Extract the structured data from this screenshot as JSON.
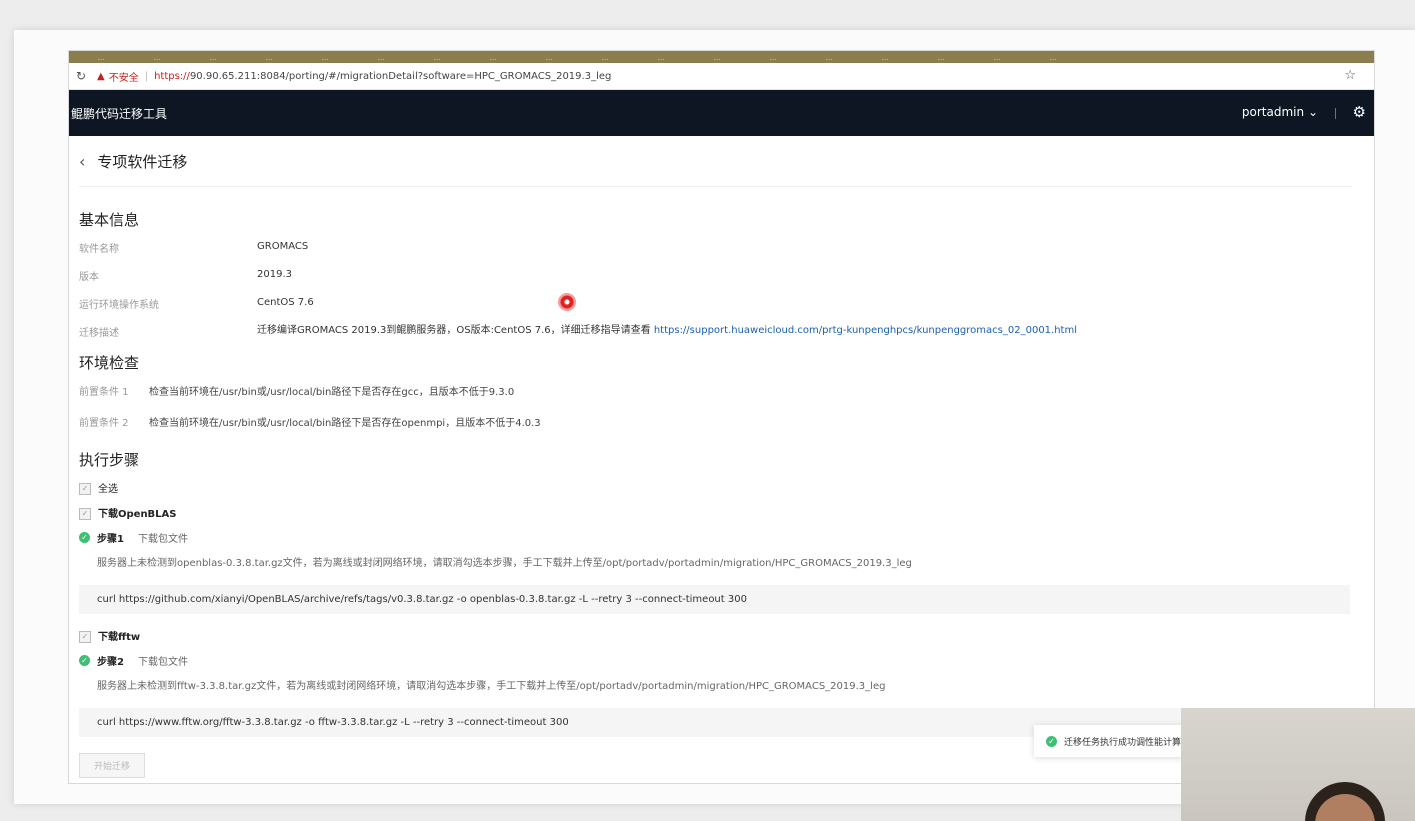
{
  "browser": {
    "tabs": [
      "...",
      "...",
      "...",
      "...",
      "...",
      "...",
      "...",
      "...",
      "...",
      "...",
      "...",
      "...",
      "...",
      "...",
      "...",
      "...",
      "...",
      "..."
    ],
    "address": {
      "insecure_label": "不安全",
      "url_https": "https://",
      "url_rest": "90.90.65.211:8084/porting/#/migrationDetail?software=HPC_GROMACS_2019.3_leg"
    }
  },
  "app": {
    "title": "鲲鹏代码迁移工具",
    "user": "portadmin"
  },
  "page": {
    "title": "专项软件迁移",
    "basic": {
      "heading": "基本信息",
      "rows": [
        {
          "label": "软件名称",
          "value": "GROMACS"
        },
        {
          "label": "版本",
          "value": "2019.3"
        },
        {
          "label": "运行环境操作系统",
          "value": "CentOS 7.6"
        }
      ],
      "desc_label": "迁移描述",
      "desc_text": "迁移编译GROMACS 2019.3到鲲鹏服务器，OS版本:CentOS 7.6，详细迁移指导请查看 ",
      "desc_link": "https://support.huaweicloud.com/prtg-kunpenghpcs/kunpenggromacs_02_0001.html"
    },
    "env": {
      "heading": "环境检查",
      "rows": [
        {
          "label": "前置条件 1",
          "value": "检查当前环境在/usr/bin或/usr/local/bin路径下是否存在gcc，且版本不低于9.3.0"
        },
        {
          "label": "前置条件 2",
          "value": "检查当前环境在/usr/bin或/usr/local/bin路径下是否存在openmpi，且版本不低于4.0.3"
        }
      ]
    },
    "steps": {
      "heading": "执行步骤",
      "select_all": "全选",
      "groups": [
        {
          "name": "下载OpenBLAS",
          "step": "步骤1",
          "step_desc": "下载包文件",
          "note": "服务器上未检测到openblas-0.3.8.tar.gz文件，若为离线或封闭网络环境，请取消勾选本步骤，手工下载并上传至/opt/portadv/portadmin/migration/HPC_GROMACS_2019.3_leg",
          "cmd": "curl https://github.com/xianyi/OpenBLAS/archive/refs/tags/v0.3.8.tar.gz -o openblas-0.3.8.tar.gz -L --retry 3 --connect-timeout 300"
        },
        {
          "name": "下载fftw",
          "step": "步骤2",
          "step_desc": "下载包文件",
          "note": "服务器上未检测到fftw-3.3.8.tar.gz文件，若为离线或封闭网络环境，请取消勾选本步骤，手工下载并上传至/opt/portadv/portadmin/migration/HPC_GROMACS_2019.3_leg",
          "cmd": "curl https://www.fftw.org/fftw-3.3.8.tar.gz -o fftw-3.3.8.tar.gz -L --retry 3 --connect-timeout 300"
        }
      ],
      "start_button": "开始迁移"
    },
    "toast": "迁移任务执行成功调性能计算"
  }
}
